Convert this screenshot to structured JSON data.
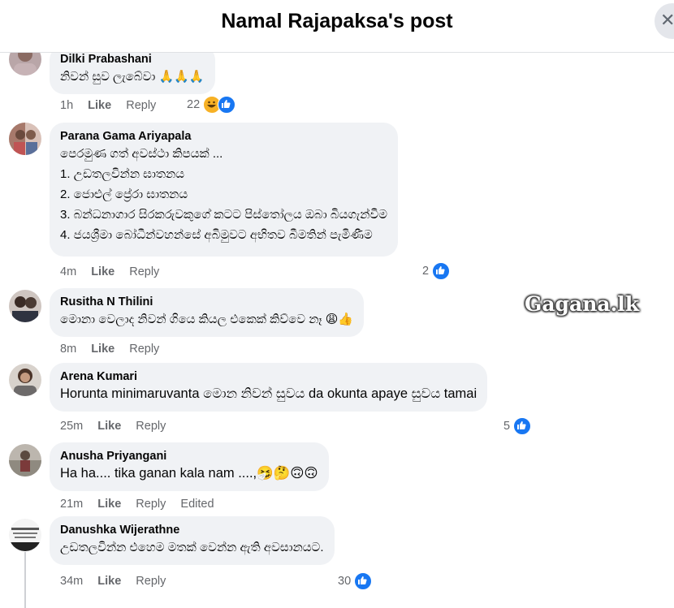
{
  "header": {
    "title": "Namal Rajapaksa's post",
    "close_icon": "close-icon"
  },
  "watermark": "Gagana.lk",
  "comments": [
    {
      "author": "Dilki Prabashani",
      "lines": [
        "නිවන් සුව ලැබේවා 🙏🙏🙏"
      ],
      "time": "1h",
      "like": "Like",
      "reply": "Reply",
      "extra": "",
      "reaction_count": "22",
      "reactions": [
        "haha",
        "like"
      ]
    },
    {
      "author": "Parana Gama Ariyapala",
      "lines": [
        "පෙරමුණ ගත් අවස්ථා කිපයක් ...",
        "1. උඩතලවින්න ඝාතනය",
        "2. ජොළුල් ප්‍රේරා ඝාතනය",
        "3. බන්ධනාගාර සිරකරුවකුගේ කටට පිස්තෝලය ඔබා බියගැන්වීම",
        "4. ජයශ්‍රීමා බෝධීන්වහන්සේ අබිමුවට අභිතව බීමතින් පැමිණීම"
      ],
      "time": "4m",
      "like": "Like",
      "reply": "Reply",
      "extra": "",
      "reaction_count": "2",
      "reactions": [
        "like"
      ]
    },
    {
      "author": "Rusitha N Thilini",
      "lines": [
        "මොනා වෙලාද නිවන් ගියෙ කියල එකෙක් කිව්වෙ නෑ 😩👍"
      ],
      "time": "8m",
      "like": "Like",
      "reply": "Reply",
      "extra": "",
      "reaction_count": "",
      "reactions": []
    },
    {
      "author": "Arena Kumari",
      "lines": [
        "Horunta minimaruvanta මොන නිවන් සුවය da okunta apaye සුවය tamai"
      ],
      "time": "25m",
      "like": "Like",
      "reply": "Reply",
      "extra": "",
      "reaction_count": "5",
      "reactions": [
        "like"
      ]
    },
    {
      "author": "Anusha Priyangani",
      "lines": [
        "Ha ha.... tika ganan kala nam ....,🤧🤔🙃🙃"
      ],
      "time": "21m",
      "like": "Like",
      "reply": "Reply",
      "extra": "Edited",
      "reaction_count": "",
      "reactions": []
    },
    {
      "author": "Danushka Wijerathne",
      "lines": [
        "උඩතලවින්න එහෙම මතක් වෙන්න ඇති අවසානයට."
      ],
      "time": "34m",
      "like": "Like",
      "reply": "Reply",
      "extra": "",
      "reaction_count": "30",
      "reactions": [
        "like"
      ]
    }
  ],
  "colors": {
    "like_blue": "#1877f2",
    "bubble_bg": "#f0f2f5",
    "meta_gray": "#65676b"
  }
}
